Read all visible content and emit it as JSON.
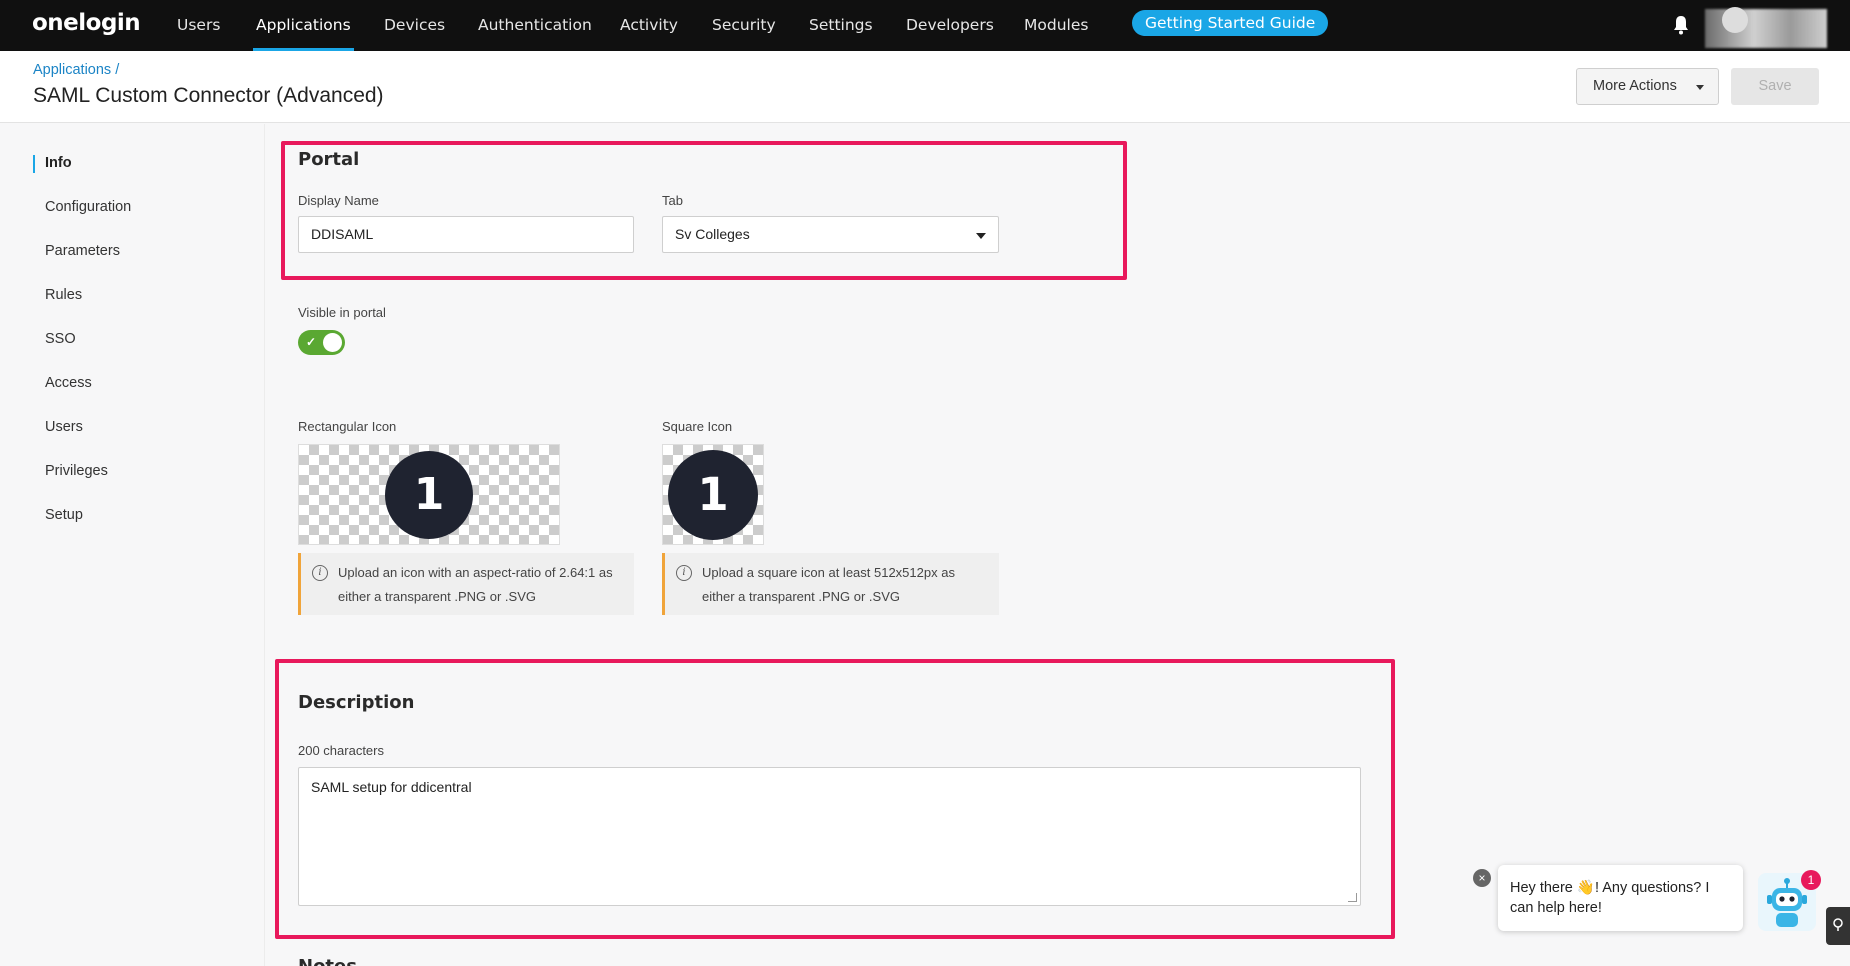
{
  "nav": {
    "logo": "onelogin",
    "items": [
      "Users",
      "Applications",
      "Devices",
      "Authentication",
      "Activity",
      "Security",
      "Settings",
      "Developers",
      "Modules"
    ],
    "active": "Applications",
    "getting_started": "Getting Started Guide"
  },
  "header": {
    "breadcrumb": "Applications /",
    "title": "SAML Custom Connector (Advanced)",
    "more_actions": "More Actions",
    "save": "Save"
  },
  "sidebar": {
    "items": [
      "Info",
      "Configuration",
      "Parameters",
      "Rules",
      "SSO",
      "Access",
      "Users",
      "Privileges",
      "Setup"
    ],
    "active": "Info"
  },
  "portal": {
    "title": "Portal",
    "display_name_label": "Display Name",
    "display_name_value": "DDISAML",
    "tab_label": "Tab",
    "tab_value": "Sv Colleges",
    "visible_label": "Visible in portal",
    "visible": true,
    "rect_icon_label": "Rectangular Icon",
    "square_icon_label": "Square Icon",
    "icon_glyph": "1",
    "rect_notice": "Upload an icon with an aspect-ratio of 2.64:1 as either a transparent .PNG or .SVG",
    "square_notice": "Upload a square icon at least 512x512px as either a transparent .PNG or .SVG"
  },
  "description": {
    "title": "Description",
    "limit_label": "200 characters",
    "value": "SAML setup for ddicentral"
  },
  "notes": {
    "title": "Notes"
  },
  "chat": {
    "message": "Hey there 👋! Any questions? I can help here!",
    "badge": "1",
    "close": "×"
  },
  "colors": {
    "accent": "#1aa6e6",
    "highlight": "#e8195c",
    "toggle_on": "#5aa832",
    "notice_border": "#f0a43a"
  }
}
